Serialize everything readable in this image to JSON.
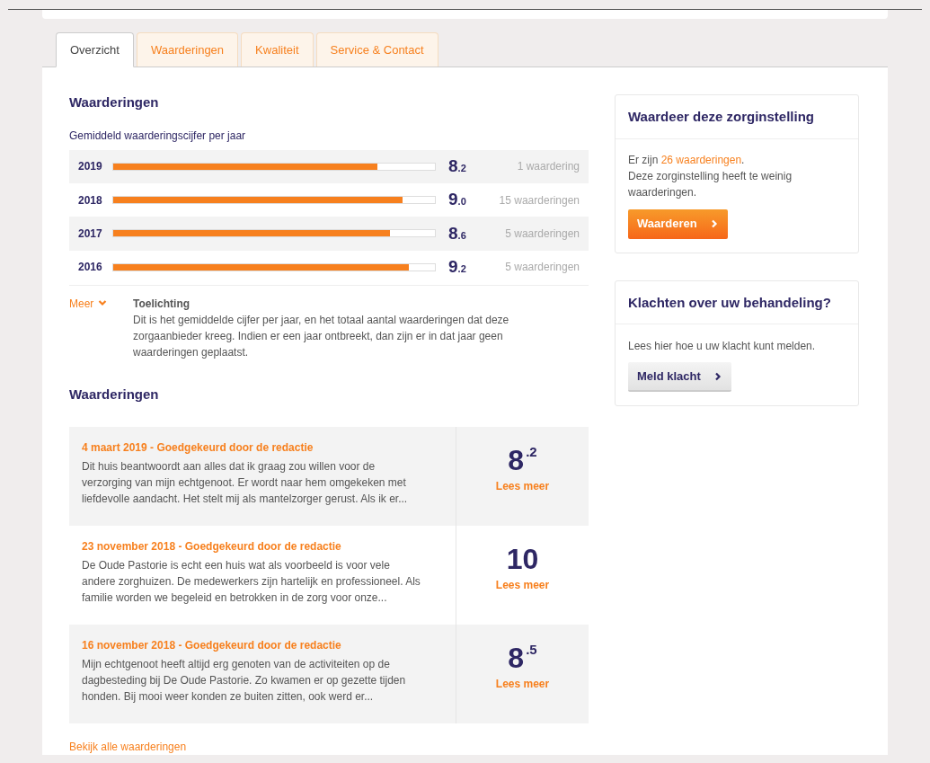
{
  "tabs": [
    {
      "label": "Overzicht",
      "selected": true
    },
    {
      "label": "Waarderingen",
      "selected": false
    },
    {
      "label": "Kwaliteit",
      "selected": false
    },
    {
      "label": "Service & Contact",
      "selected": false
    }
  ],
  "ratings": {
    "heading": "Waarderingen",
    "subheading": "Gemiddeld waarderingscijfer per jaar",
    "years": [
      {
        "year": "2019",
        "level": 0.82,
        "score": "8",
        "decimal": ".2",
        "count": "1 waardering"
      },
      {
        "year": "2018",
        "level": 0.9,
        "score": "9",
        "decimal": ".0",
        "count": "15 waarderingen"
      },
      {
        "year": "2017",
        "level": 0.86,
        "score": "8",
        "decimal": ".6",
        "count": "5 waarderingen"
      },
      {
        "year": "2016",
        "level": 0.92,
        "score": "9",
        "decimal": ".2",
        "count": "5 waarderingen"
      }
    ],
    "more_link": "Meer",
    "explanation_title": "Toelichting",
    "explanation": "Dit is het gemiddelde cijfer per jaar, en het totaal aantal waarderingen dat deze zorgaanbieder kreeg. Indien er een jaar ontbreekt, dan zijn er in dat jaar geen waarderingen geplaatst."
  },
  "reviews": {
    "heading": "Waarderingen",
    "items": [
      {
        "title": "4 maart 2019 - Goedgekeurd door de redactie",
        "text": "Dit huis beantwoordt aan alles dat ik graag zou willen voor de verzorging van mijn echtgenoot. Er wordt naar hem omgekeken met liefdevolle aandacht. Het stelt mij als mantelzorger gerust. Als ik er...",
        "score": "8",
        "decimal": ".2",
        "link": "Lees meer"
      },
      {
        "title": "23 november 2018 - Goedgekeurd door de redactie",
        "text": "De Oude Pastorie is echt een huis wat als voorbeeld is voor vele andere zorghuizen. De medewerkers zijn hartelijk en professioneel. Als familie worden we begeleid en betrokken in de zorg voor onze...",
        "score": "10",
        "link": "Lees meer"
      },
      {
        "title": "16 november 2018 - Goedgekeurd door de redactie",
        "text": "Mijn echtgenoot heeft altijd erg genoten van de activiteiten op de dagbesteding bij De Oude Pastorie. Zo kwamen er op gezette tijden honden. Bij mooi weer konden ze buiten zitten, ook werd er...",
        "score": "8",
        "decimal": ".5",
        "link": "Lees meer"
      }
    ],
    "all_link": "Bekijk alle waarderingen"
  },
  "rate_card": {
    "title": "Waardeer deze zorginstelling",
    "count_prefix": "Er zijn ",
    "count_link": "26 waarderingen",
    "count_suffix": ".",
    "note": "Deze zorginstelling heeft te weinig waarderingen.",
    "button": "Waarderen"
  },
  "complaint_card": {
    "title": "Klachten over uw behandeling?",
    "text": "Lees hier hoe u uw klacht kunt melden.",
    "button": "Meld klacht"
  }
}
